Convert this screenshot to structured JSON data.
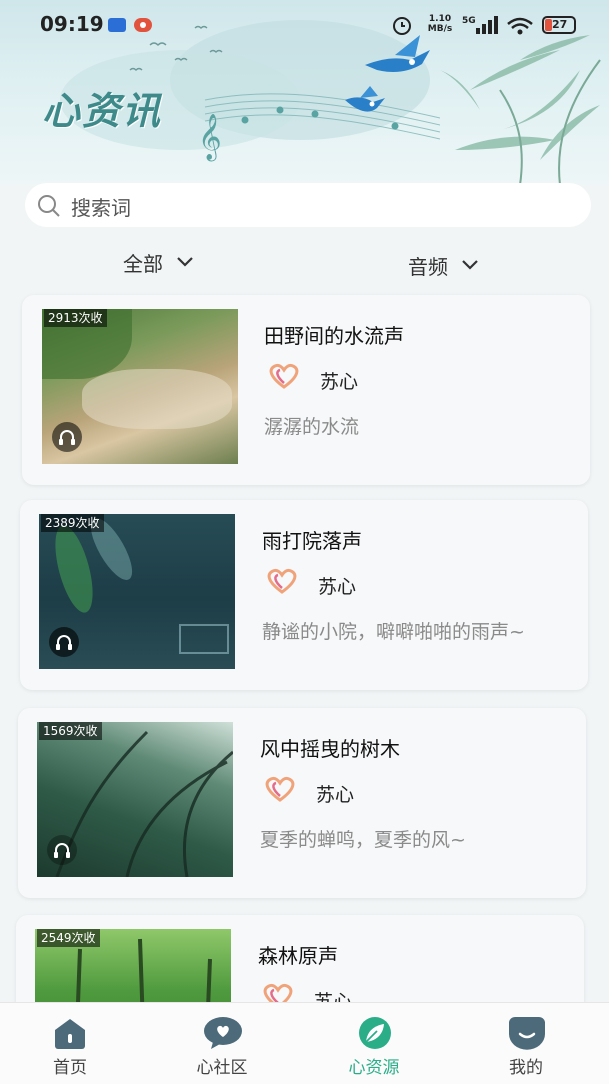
{
  "status_bar": {
    "time": "09:19",
    "net_speed": "1.10",
    "net_unit": "MB/s",
    "signal": "5G",
    "battery": "27"
  },
  "header": {
    "title": "心资讯"
  },
  "search": {
    "placeholder": "搜索词"
  },
  "filters": {
    "category": "全部",
    "type": "音频"
  },
  "cards": [
    {
      "count": "2913次收",
      "title": "田野间的水流声",
      "author": "苏心",
      "desc": "潺潺的水流"
    },
    {
      "count": "2389次收",
      "title": "雨打院落声",
      "author": "苏心",
      "desc": "静谧的小院，噼噼啪啪的雨声~"
    },
    {
      "count": "1569次收",
      "title": "风中摇曳的树木",
      "author": "苏心",
      "desc": "夏季的蝉鸣，夏季的风~"
    },
    {
      "count": "2549次收",
      "title": "森林原声",
      "author": "苏心",
      "desc": ""
    }
  ],
  "tabs": [
    {
      "label": "首页",
      "icon": "home-icon"
    },
    {
      "label": "心社区",
      "icon": "community-heart-icon"
    },
    {
      "label": "心资源",
      "icon": "leaf-resource-icon"
    },
    {
      "label": "我的",
      "icon": "smile-profile-icon"
    }
  ],
  "colors": {
    "accent": "#2bae88",
    "title_teal": "#3e8a8a",
    "bird_blue": "#2a7fc9",
    "background": "#f1f5f6"
  }
}
